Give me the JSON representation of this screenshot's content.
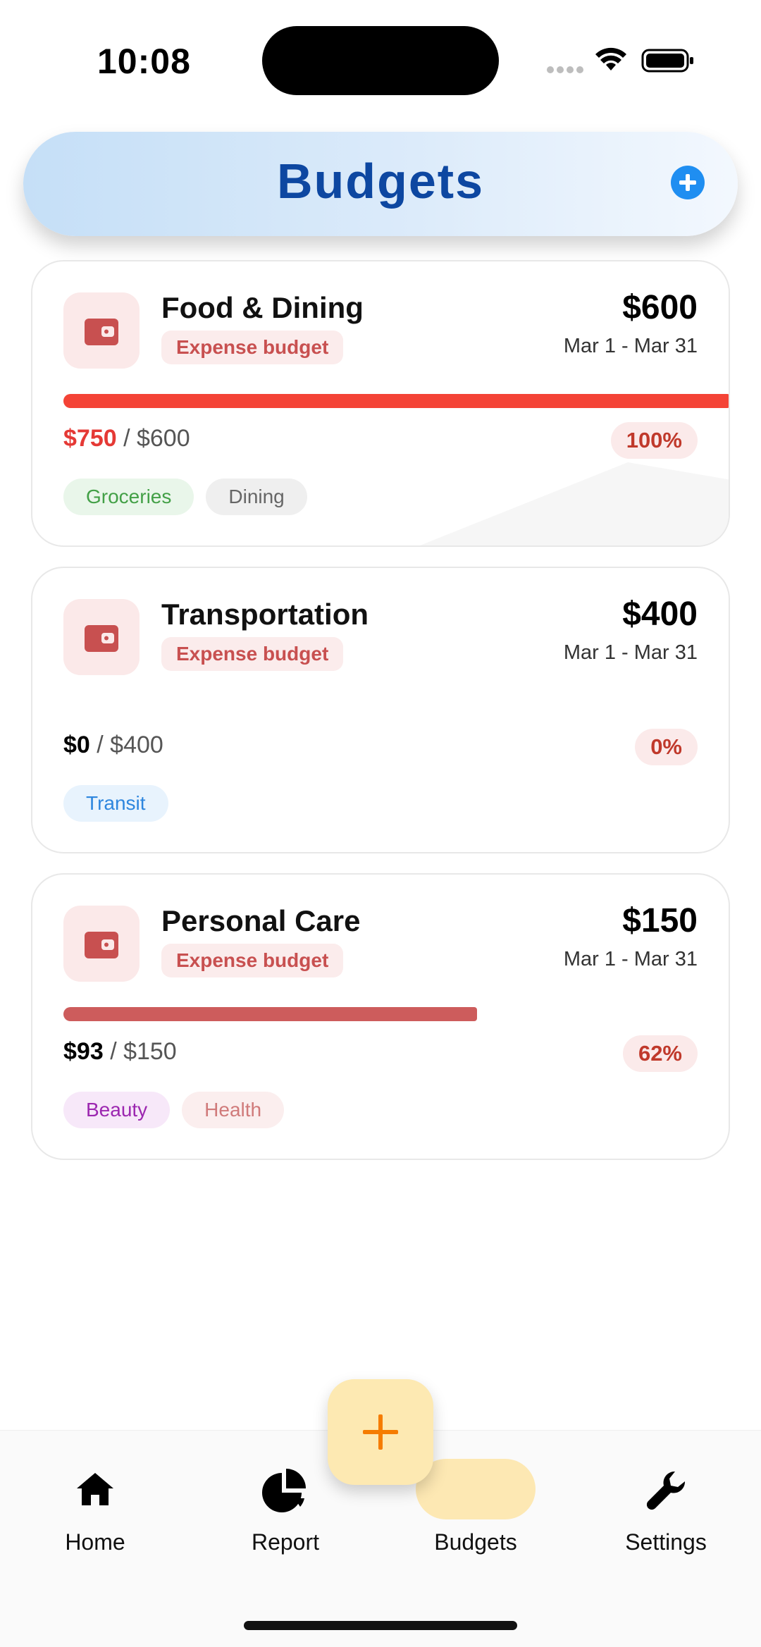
{
  "status_bar": {
    "time": "10:08"
  },
  "header": {
    "title": "Budgets",
    "add_icon": "plus-circle-icon",
    "accent": "#1f8ef1"
  },
  "budgets": [
    {
      "name": "Food & Dining",
      "type": "Expense budget",
      "amount": "$600",
      "dates": "Mar 1 - Mar 31",
      "spent": "$750",
      "total": "/ $600",
      "percent": "100%",
      "progress": 1.0,
      "bar_color": "#f44336",
      "spent_color": "#e53935",
      "tags": [
        {
          "label": "Groceries",
          "bg": "#e9f6ea",
          "color": "#43a047"
        },
        {
          "label": "Dining",
          "bg": "#efefef",
          "color": "#666666"
        }
      ]
    },
    {
      "name": "Transportation",
      "type": "Expense budget",
      "amount": "$400",
      "dates": "Mar 1 - Mar 31",
      "spent": "$0",
      "total": "/ $400",
      "percent": "0%",
      "progress": 0.0,
      "bar_color": "#cd5c5c",
      "spent_color": "#000000",
      "tags": [
        {
          "label": "Transit",
          "bg": "#e8f3fd",
          "color": "#2e86de"
        }
      ]
    },
    {
      "name": "Personal Care",
      "type": "Expense budget",
      "amount": "$150",
      "dates": "Mar 1 - Mar 31",
      "spent": "$93",
      "total": "/ $150",
      "percent": "62%",
      "progress": 0.62,
      "bar_color": "#cd5c5c",
      "spent_color": "#000000",
      "tags": [
        {
          "label": "Beauty",
          "bg": "#f7e8f9",
          "color": "#9c27b0"
        },
        {
          "label": "Health",
          "bg": "#fbeeee",
          "color": "#d07a7a"
        }
      ]
    }
  ],
  "nav": {
    "items": [
      {
        "label": "Home",
        "icon": "home-icon"
      },
      {
        "label": "Report",
        "icon": "pie-chart-icon"
      },
      {
        "label": "Budgets",
        "icon": "piggy-bank-icon",
        "active": true
      },
      {
        "label": "Settings",
        "icon": "wrench-icon"
      }
    ],
    "fab_icon": "plus-icon",
    "active_color": "#f57c00"
  }
}
